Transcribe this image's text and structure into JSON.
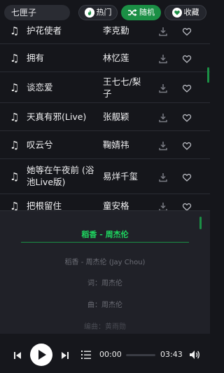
{
  "search": {
    "value": "七匣子"
  },
  "tabs": {
    "hot": "热门",
    "random": "随机",
    "favorites": "收藏"
  },
  "songs": [
    {
      "title": "护花使者",
      "artist": "李克勤"
    },
    {
      "title": "拥有",
      "artist": "林忆莲"
    },
    {
      "title": "谈恋爱",
      "artist": "王七七/梨子"
    },
    {
      "title": "天真有邪(Live)",
      "artist": "张靓颖"
    },
    {
      "title": "叹云兮",
      "artist": "鞠婧祎"
    },
    {
      "title": "她等在午夜前 (浴池Live版)",
      "artist": "易烊千玺"
    },
    {
      "title": "把根留住",
      "artist": "童安格"
    }
  ],
  "lyrics": {
    "current_song": "稻香 - 周杰伦",
    "lines": [
      "稻香 - 周杰伦 (Jay Chou)",
      "词：周杰伦",
      "曲：周杰伦",
      "编曲：黄雨勋"
    ]
  },
  "player": {
    "current_time": "00:00",
    "total_time": "03:43",
    "progress": 0
  },
  "colors": {
    "accent": "#1b8f45",
    "lyric_highlight": "#1ed760",
    "background": "#15161b"
  }
}
